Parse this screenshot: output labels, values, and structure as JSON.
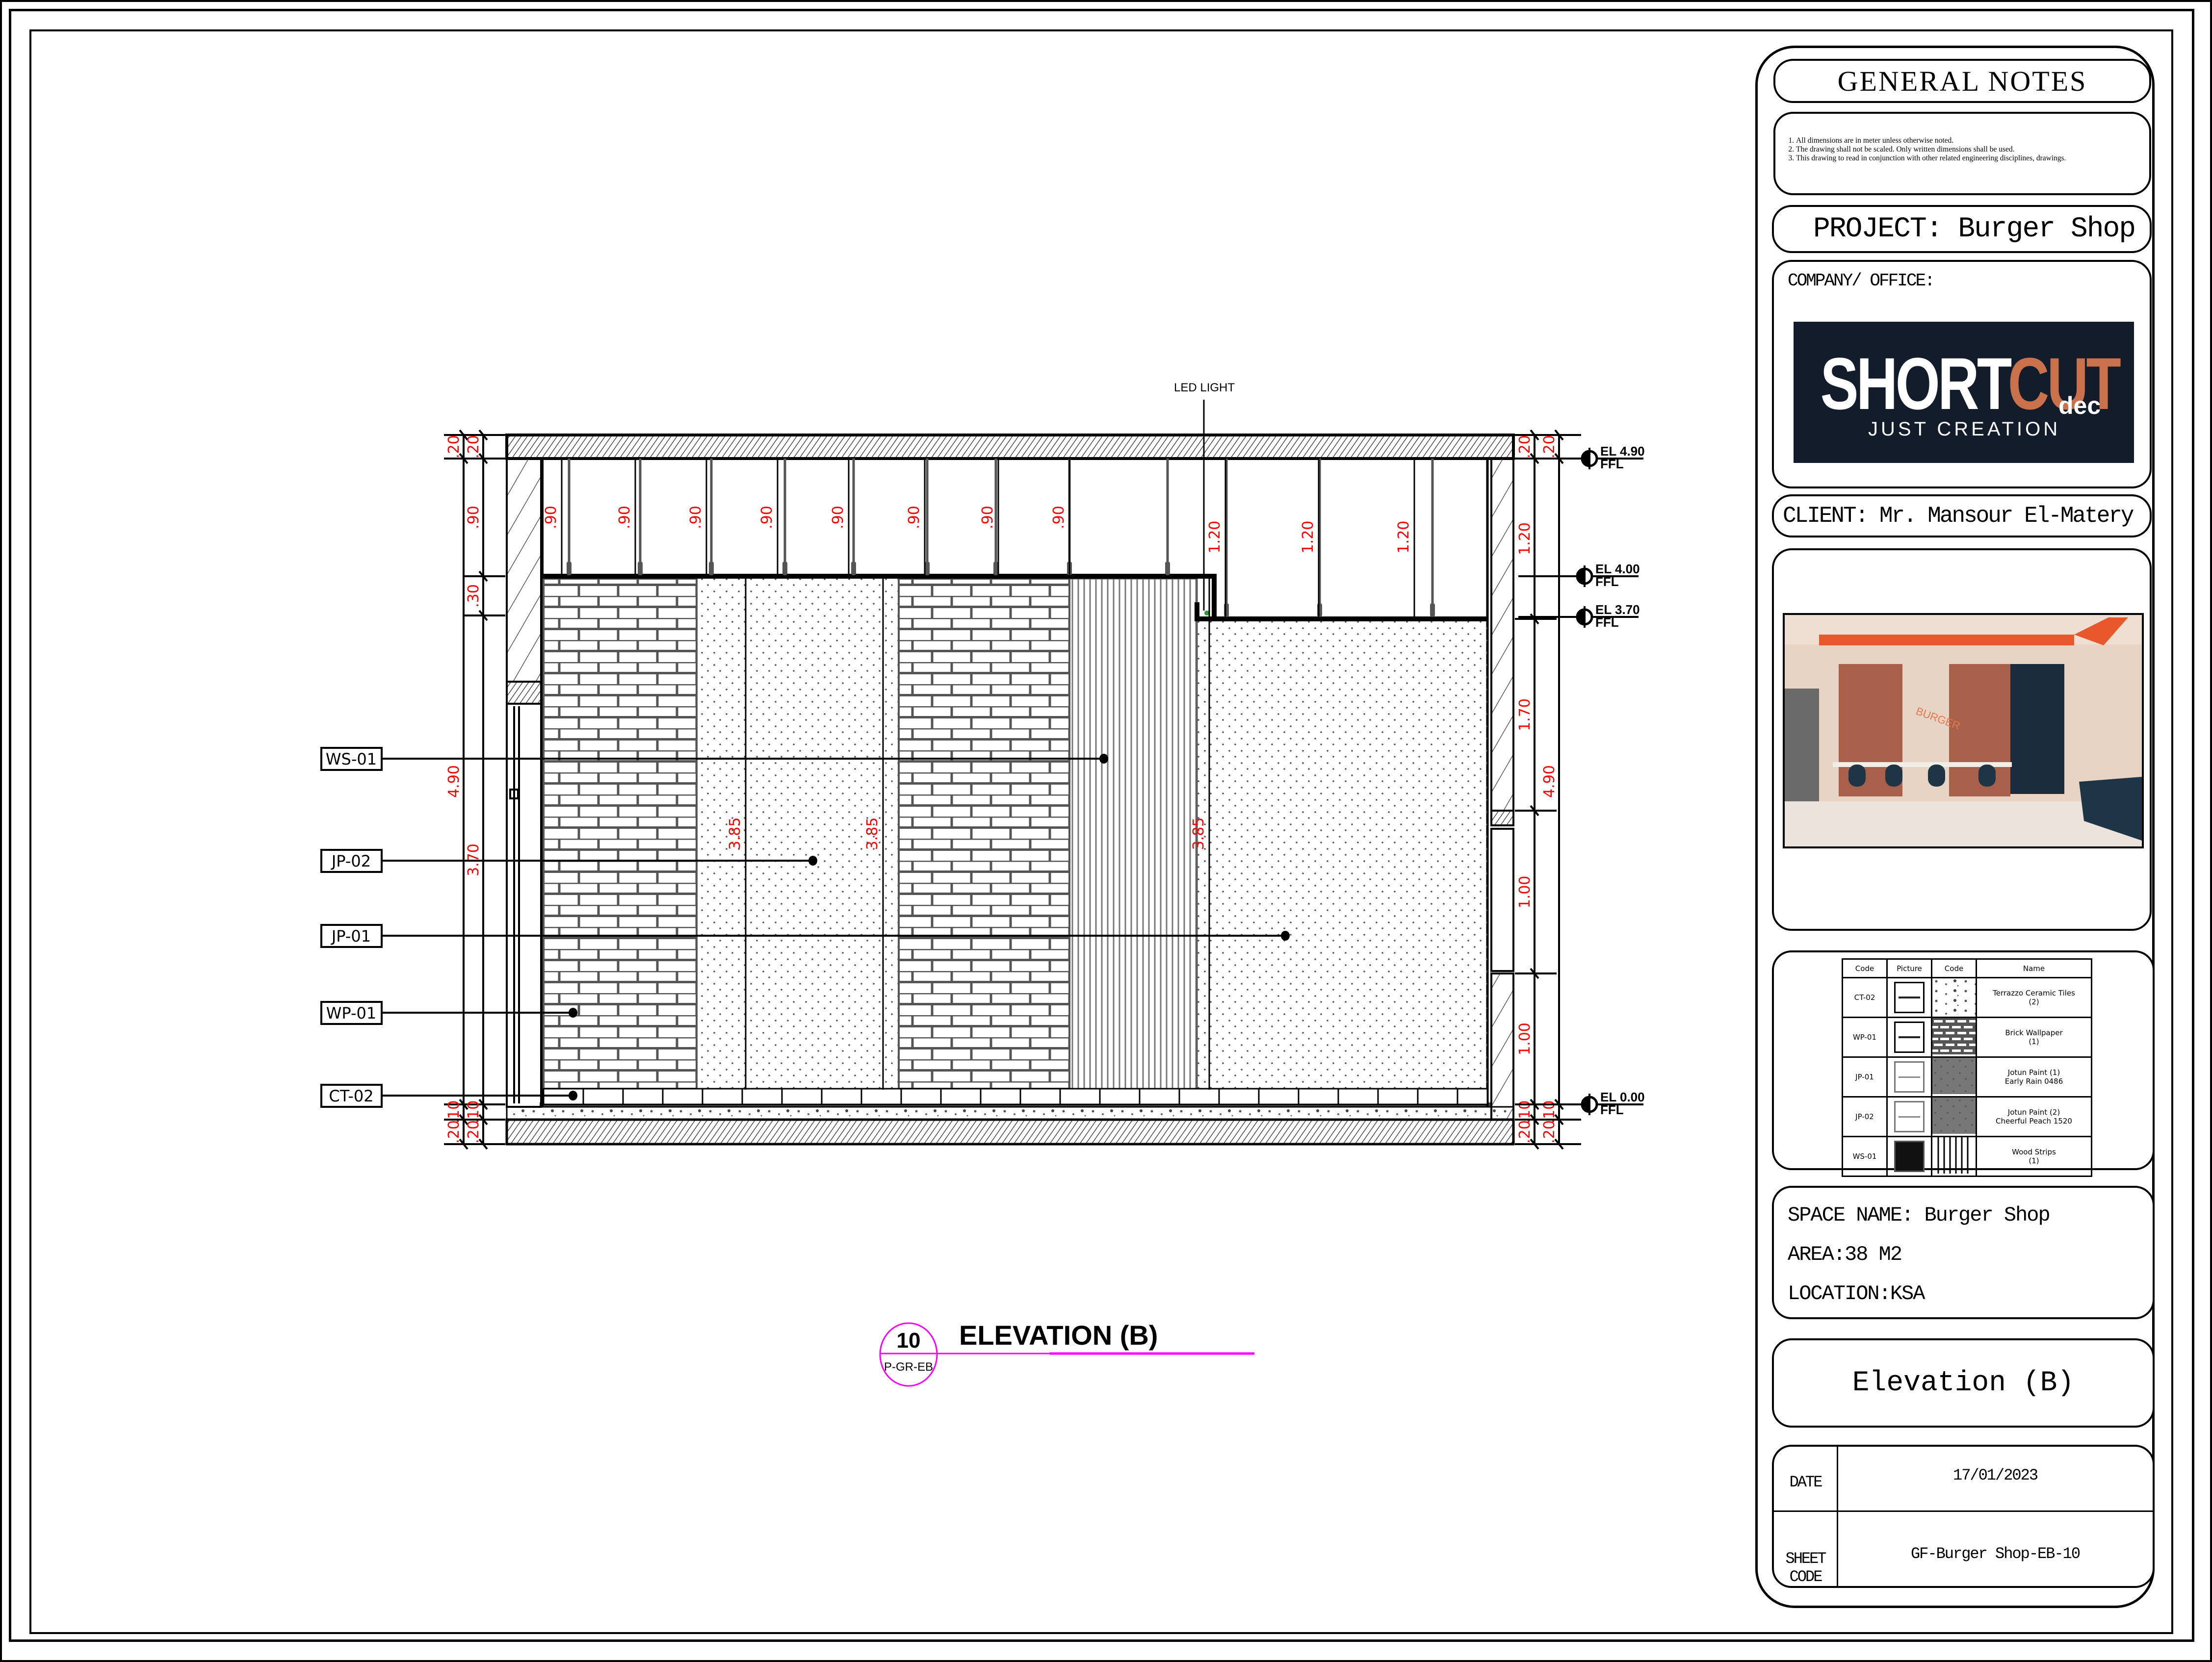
{
  "sheet": {
    "drawing_title": "ELEVATION (B)",
    "view_number": "10",
    "view_ref": "P-GR-EB",
    "led_label": "LED LIGHT",
    "accent_color": "#ff00ff",
    "dimension_color": "#ff0000"
  },
  "material_tags": [
    {
      "code": "WS-01"
    },
    {
      "code": "JP-02"
    },
    {
      "code": "JP-01"
    },
    {
      "code": "WP-01"
    },
    {
      "code": "CT-02"
    }
  ],
  "elevation_marks": [
    {
      "label": "EL 4.90",
      "sub": "FFL"
    },
    {
      "label": "EL 4.00",
      "sub": "FFL"
    },
    {
      "label": "EL 3.70",
      "sub": "FFL"
    },
    {
      "label": "EL 0.00",
      "sub": "FFL"
    }
  ],
  "dimensions": {
    "left_outer": {
      "top": ".20",
      "total": "4.90",
      "bottom_a": ".10",
      "bottom_b": ".20"
    },
    "left_inner": {
      "top": ".20",
      "upper": ".90",
      "gap": ".30",
      "main": "3.70",
      "bottom_a": ".10",
      "bottom_b": ".20"
    },
    "ceiling_drops": [
      ".90",
      ".90",
      ".90",
      ".90",
      ".90",
      ".90",
      ".90",
      ".90"
    ],
    "ceiling_drops_low": [
      "1.20",
      "1.20",
      "1.20"
    ],
    "wall_heights": [
      "3.85",
      "3.85",
      "3.85"
    ],
    "right_inner": {
      "top": ".20",
      "upper": "1.20",
      "mid": "1.70",
      "window": "1.00",
      "lower": "1.00",
      "bottom_a": ".10",
      "bottom_b": ".20"
    },
    "right_outer": {
      "top": ".20",
      "total": "4.90",
      "bottom_a": ".10",
      "bottom_b": ".20"
    }
  },
  "title_block": {
    "general_notes_title": "GENERAL NOTES",
    "notes": [
      "All dimensions are in meter unless otherwise noted.",
      "The drawing shall not be scaled. Only written dimensions shall be used.",
      "This drawing to read in conjunction with other related engineering disciplines, drawings."
    ],
    "project": "PROJECT: Burger Shop",
    "company_label": "COMPANY/ OFFICE:",
    "logo": {
      "word_white": "SHORT",
      "word_accent": "CUT",
      "suffix": "dec",
      "tagline": "JUST CREATION",
      "bg_color": "#131c2b",
      "accent_color": "#c8714a"
    },
    "client": "CLIENT: Mr. Mansour El-Matery",
    "legend": {
      "headers": [
        "Code",
        "Picture",
        "Code",
        "Name"
      ],
      "rows": [
        {
          "code": "CT-02",
          "pattern": "terrazzo",
          "name_1": "Terrazzo Ceramic Tiles",
          "name_2": "(2)"
        },
        {
          "code": "WP-01",
          "pattern": "brick",
          "name_1": "Brick Wallpaper",
          "name_2": "(1)"
        },
        {
          "code": "JP-01",
          "pattern": "dots",
          "name_1": "Jotun Paint (1)",
          "name_2": "Early Rain 0486"
        },
        {
          "code": "JP-02",
          "pattern": "dots",
          "name_1": "Jotun Paint (2)",
          "name_2": "Cheerful Peach 1520"
        },
        {
          "code": "WS-01",
          "pattern": "strips",
          "name_1": "Wood Strips",
          "name_2": "(1)"
        }
      ]
    },
    "space_name": "SPACE NAME: Burger Shop",
    "area": "AREA:38 M2",
    "location": "LOCATION:KSA",
    "sheet_title": "Elevation (B)",
    "date_label": "DATE",
    "date_value": "17/01/2023",
    "sheet_code_label": "SHEET CODE",
    "sheet_code_value": "GF-Burger Shop-EB-10",
    "render_neon_text": "BURGER"
  }
}
